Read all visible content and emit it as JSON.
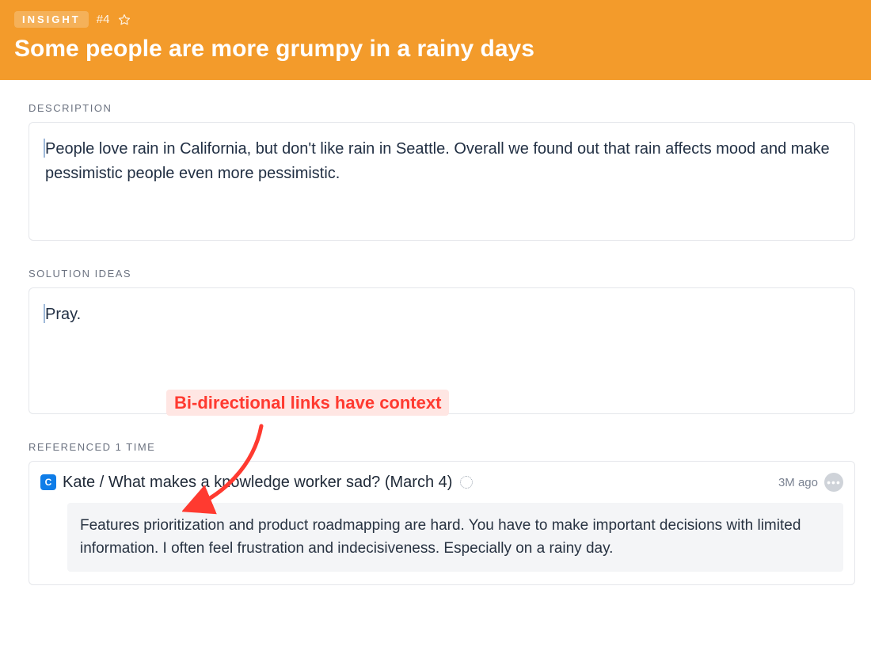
{
  "header": {
    "badge": "INSIGHT",
    "issue_number": "#4",
    "title": "Some people are more grumpy in a rainy days"
  },
  "sections": {
    "description": {
      "label": "DESCRIPTION",
      "text": "People love rain in California, but don't like rain in Seattle. Overall we found out that rain affects mood and make pessimistic people even more pessimistic."
    },
    "solution_ideas": {
      "label": "SOLUTION IDEAS",
      "text": "Pray."
    },
    "references": {
      "label": "REFERENCED 1 TIME",
      "item": {
        "chip": "C",
        "title": "Kate / What makes a knowledge worker sad? (March 4)",
        "timestamp": "3M ago",
        "quote": "Features prioritization and product roadmapping are hard. You have to make important decisions with limited information. I often feel frustration and indecisiveness. Especially on a rainy day."
      }
    }
  },
  "annotation": {
    "text": "Bi-directional links have context"
  }
}
